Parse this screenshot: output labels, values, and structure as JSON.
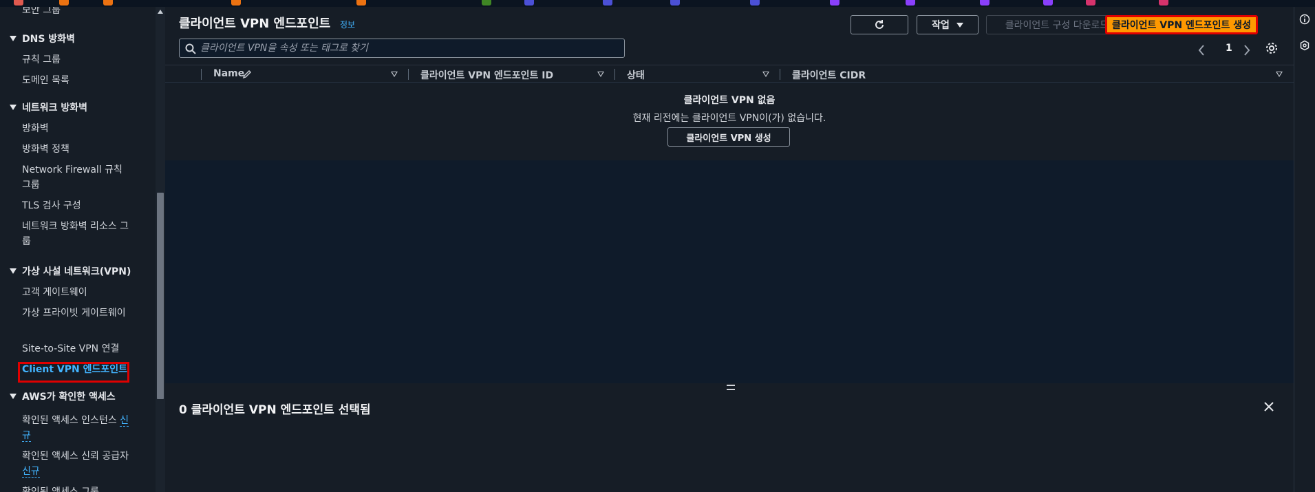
{
  "sidebar": {
    "partial_top": "보안 그룹",
    "sections": [
      {
        "title": "DNS 방화벽",
        "items": [
          "규칙 그룹",
          "도메인 목록"
        ]
      },
      {
        "title": "네트워크 방화벽",
        "items": [
          "방화벽",
          "방화벽 정책",
          "Network Firewall 규칙 그룹",
          "TLS 검사 구성",
          "네트워크 방화벽 리소스 그룹"
        ]
      },
      {
        "title": "가상 사설 네트워크(VPN)",
        "items": [
          "고객 게이트웨이",
          "가상 프라이빗 게이트웨이",
          "Site-to-Site VPN 연결",
          "Client VPN 엔드포인트"
        ]
      },
      {
        "title": "AWS가 확인한 액세스",
        "items": [
          "확인된 액세스 인스턴스",
          "확인된 액세스 신뢰 공급자",
          "확인된 액세스 그룹"
        ]
      }
    ],
    "new_badge": "신규"
  },
  "header": {
    "title": "클라이언트 VPN 엔드포인트",
    "info": "정보",
    "action_label": "작업",
    "download_label": "클라이언트 구성 다운로드",
    "create_label": "클라이언트 VPN 엔드포인트 생성"
  },
  "search": {
    "placeholder": "클라이언트 VPN을 속성 또는 태그로 찾기"
  },
  "pagination": {
    "current": "1"
  },
  "table": {
    "columns": [
      "Name",
      "클라이언트 VPN 엔드포인트 ID",
      "상태",
      "클라이언트 CIDR"
    ]
  },
  "empty_state": {
    "title": "클라이언트 VPN 없음",
    "description": "현재 리전에는 클라이언트 VPN이(가) 없습니다.",
    "button": "클라이언트 VPN 생성"
  },
  "bottom_panel": {
    "title": "0 클라이언트 VPN 엔드포인트 선택됨"
  },
  "colors": {
    "accent": "#ff9900",
    "link": "#42b4ff",
    "highlight": "#e00000"
  }
}
